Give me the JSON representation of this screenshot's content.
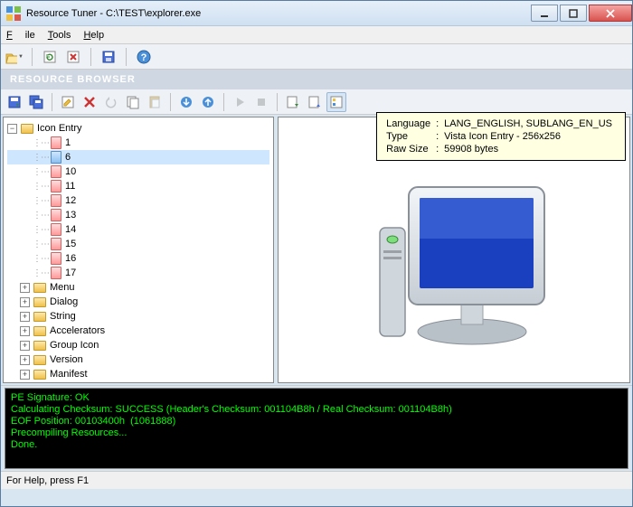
{
  "window": {
    "title": "Resource Tuner - C:\\TEST\\explorer.exe"
  },
  "menu": {
    "file": "File",
    "tools": "Tools",
    "help": "Help"
  },
  "section_header": "RESOURCE BROWSER",
  "tree": {
    "root": "Icon Entry",
    "items": [
      "1",
      "6",
      "10",
      "11",
      "12",
      "13",
      "14",
      "15",
      "16",
      "17"
    ],
    "selected": "6",
    "folders": [
      "Menu",
      "Dialog",
      "String",
      "Accelerators",
      "Group Icon",
      "Version",
      "Manifest"
    ]
  },
  "tooltip": {
    "lang_label": "Language",
    "lang_value": "LANG_ENGLISH, SUBLANG_EN_US",
    "type_label": "Type",
    "type_value": "Vista Icon Entry - 256x256",
    "size_label": "Raw Size",
    "size_value": "59908 bytes"
  },
  "console": {
    "l1": "PE Signature: OK",
    "l2": "Calculating Checksum: SUCCESS (Header's Checksum: 001104B8h / Real Checksum: 001104B8h)",
    "l3": "EOF Position: 00103400h  (1061888)",
    "l4": "Precompiling Resources...",
    "l5": "Done."
  },
  "statusbar": "For Help, press F1"
}
